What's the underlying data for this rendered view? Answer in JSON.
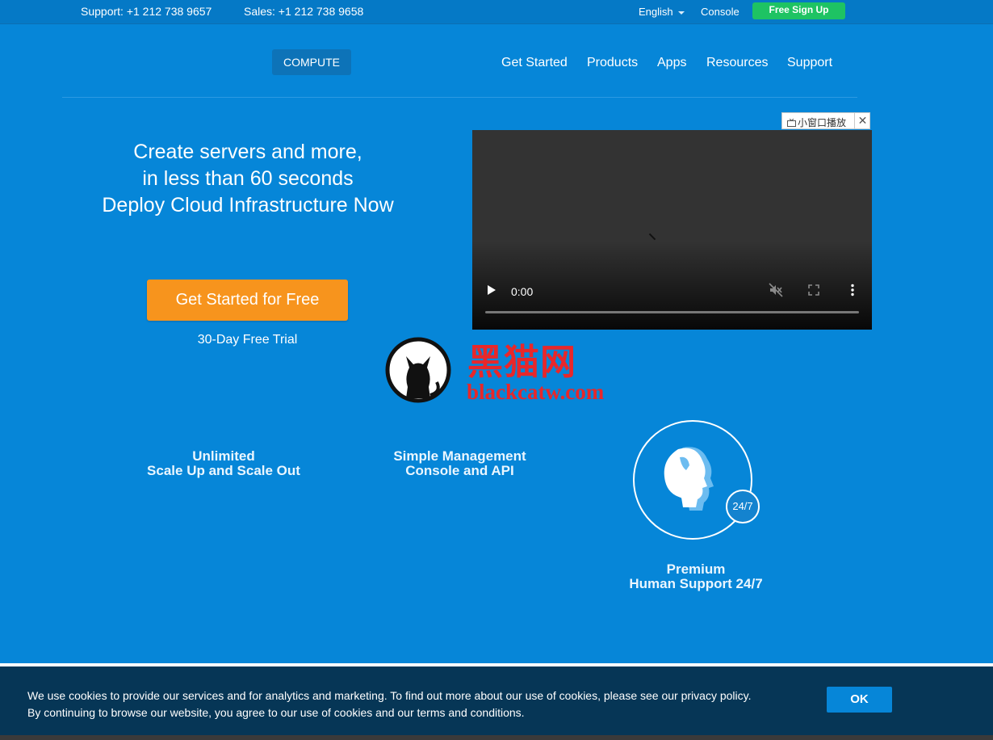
{
  "topbar": {
    "support": "Support: +1 212 738 9657",
    "sales": "Sales: +1 212 738 9658",
    "language": "English",
    "console": "Console",
    "signup": "Free Sign Up"
  },
  "nav": {
    "compute": "COMPUTE",
    "items": [
      {
        "label": "Get Started"
      },
      {
        "label": "Products"
      },
      {
        "label": "Apps"
      },
      {
        "label": "Resources"
      },
      {
        "label": "Support"
      }
    ]
  },
  "hero": {
    "lines": [
      "Create servers and more,",
      "in less than 60 seconds",
      "Deploy Cloud Infrastructure Now"
    ],
    "cta": "Get Started for Free",
    "trial": "30-Day Free Trial"
  },
  "video": {
    "time": "0:00",
    "pip_label": "小窗口播放",
    "pip_close": "✕"
  },
  "watermark": {
    "cn": "黑猫网",
    "en": "blackcatw.com"
  },
  "features": [
    {
      "line1": "Unlimited",
      "line2": "Scale Up and Scale Out"
    },
    {
      "line1": "Simple Management",
      "line2": "Console and API"
    },
    {
      "line1": "Premium",
      "line2": "Human Support 24/7",
      "badge": "24/7",
      "icon": "support-head-icon"
    }
  ],
  "cookie": {
    "line1": "We use cookies to provide our services and for analytics and marketing. To find out more about our use of cookies, please see our privacy policy.",
    "line2": "By continuing to browse our website, you agree to our use of cookies and our terms and conditions.",
    "ok": "OK"
  },
  "colors": {
    "background": "#0686d8",
    "cta": "#f7941d",
    "signup": "#1ec363",
    "cookie_bar": "#063656",
    "watermark": "#e8272a"
  }
}
